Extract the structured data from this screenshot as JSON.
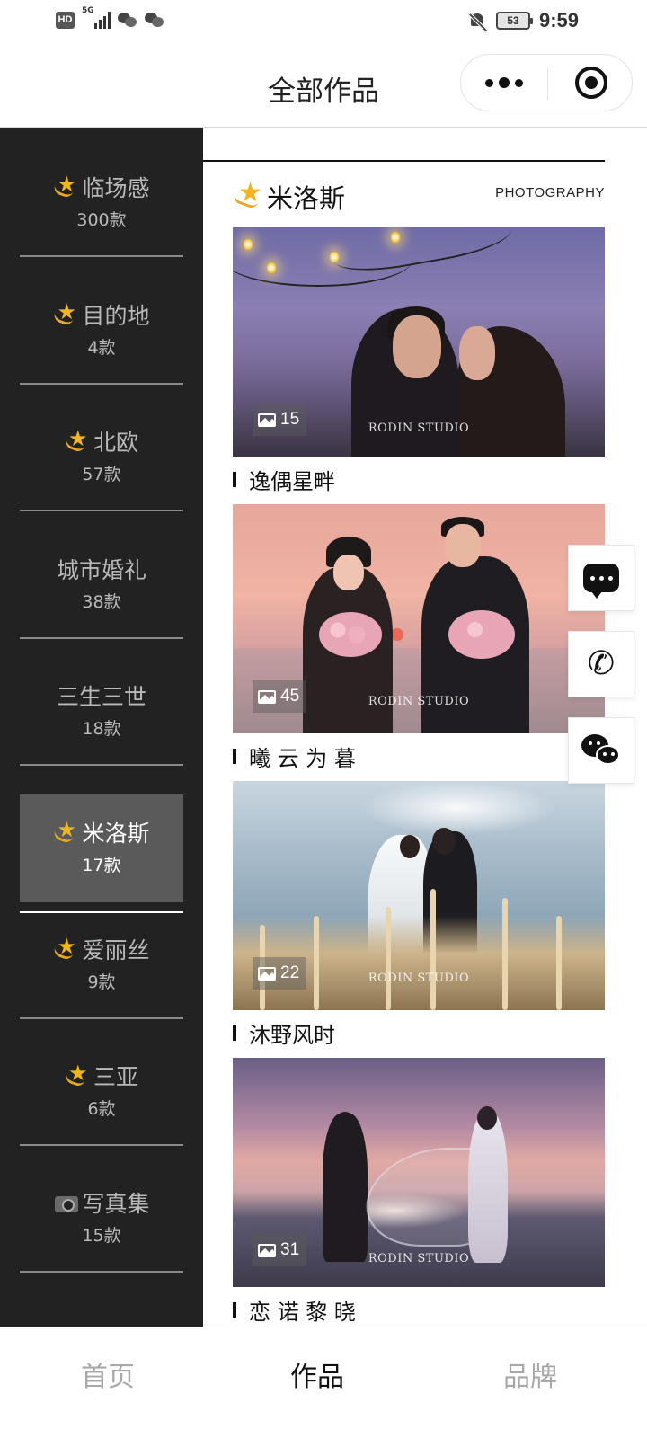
{
  "status_bar": {
    "hd": "HD",
    "network": "5G",
    "battery": "53",
    "time": "9:59"
  },
  "nav": {
    "title": "全部作品"
  },
  "sidebar": {
    "items": [
      {
        "name": "临场感",
        "count": "300款",
        "icon": "shooting-star-icon",
        "active": false
      },
      {
        "name": "目的地",
        "count": "4款",
        "icon": "shooting-star-icon",
        "active": false
      },
      {
        "name": "北欧",
        "count": "57款",
        "icon": "shooting-star-icon",
        "active": false
      },
      {
        "name": "城市婚礼",
        "count": "38款",
        "icon": "",
        "active": false
      },
      {
        "name": "三生三世",
        "count": "18款",
        "icon": "",
        "active": false
      },
      {
        "name": "米洛斯",
        "count": "17款",
        "icon": "shooting-star-icon",
        "active": true
      },
      {
        "name": "爱丽丝",
        "count": "9款",
        "icon": "shooting-star-icon",
        "active": false
      },
      {
        "name": "三亚",
        "count": "6款",
        "icon": "shooting-star-icon",
        "active": false
      },
      {
        "name": "写真集",
        "count": "15款",
        "icon": "camera-icon",
        "active": false
      }
    ]
  },
  "section": {
    "title": "米洛斯",
    "tag": "PHOTOGRAPHY"
  },
  "albums": [
    {
      "title": "逸偶星畔",
      "photo_count": "15",
      "watermark": "RODIN STUDIO"
    },
    {
      "title": "曦 云 为 暮",
      "photo_count": "45",
      "watermark": "RODIN STUDIO"
    },
    {
      "title": "沐野风时",
      "photo_count": "22",
      "watermark": "RODIN STUDIO"
    },
    {
      "title": "恋 诺 黎 晓",
      "photo_count": "31",
      "watermark": "RODIN STUDIO"
    }
  ],
  "floating_actions": [
    "message-icon",
    "phone-icon",
    "wechat-icon"
  ],
  "tabs": [
    {
      "label": "首页",
      "active": false
    },
    {
      "label": "作品",
      "active": true
    },
    {
      "label": "品牌",
      "active": false
    }
  ],
  "colors": {
    "sidebar_bg": "#222222",
    "sidebar_active_bg": "#5a5a5a",
    "sidebar_text": "#b9b9b9",
    "accent_star": "#f2b51f",
    "tab_inactive": "#a8a8a8"
  }
}
